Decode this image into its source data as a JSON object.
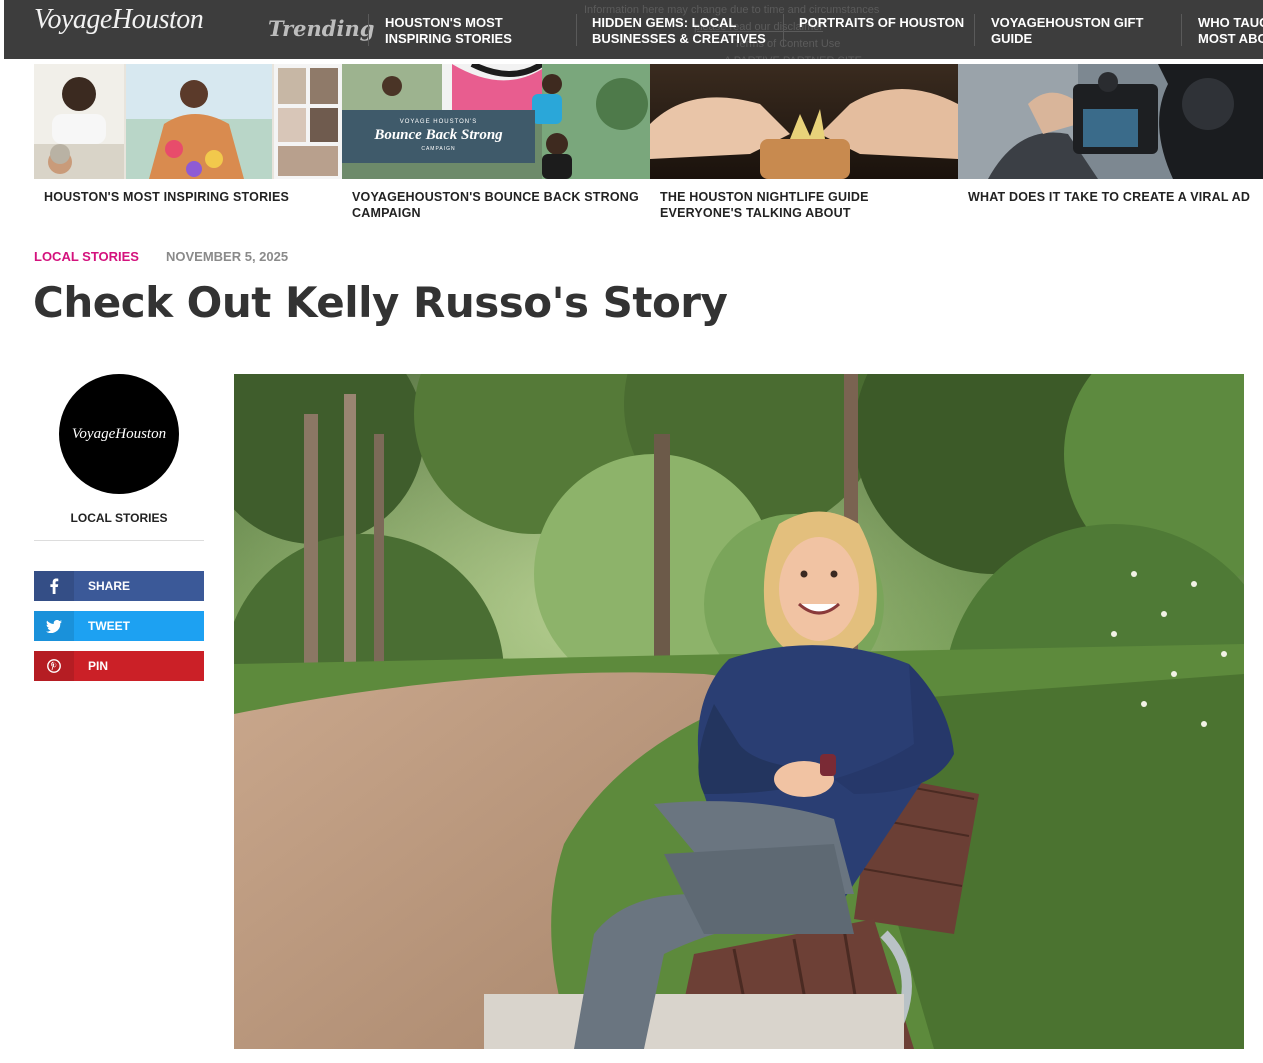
{
  "site": {
    "logo": "VoyageHouston",
    "trending_label": "Trending"
  },
  "nav": [
    {
      "label": "Houston's Most Inspiring Stories"
    },
    {
      "label": "Hidden Gems: Local Businesses & Creatives"
    },
    {
      "label": "Portraits of Houston"
    },
    {
      "label": "VoyageHouston Gift Guide"
    },
    {
      "label": "Who Taught You Most About"
    }
  ],
  "cards": [
    {
      "caption": "HOUSTON'S MOST INSPIRING STORIES"
    },
    {
      "caption": "VOYAGEHOUSTON'S BOUNCE BACK STRONG CAMPAIGN",
      "overlay_kicker": "VOYAGE HOUSTON'S",
      "overlay_title": "Bounce Back Strong",
      "overlay_sub": "CAMPAIGN"
    },
    {
      "caption": "THE HOUSTON NIGHTLIFE GUIDE EVERYONE'S TALKING ABOUT"
    },
    {
      "caption": "WHAT DOES IT TAKE TO CREATE A VIRAL AD"
    }
  ],
  "article": {
    "category": "LOCAL STORIES",
    "date": "NOVEMBER 5, 2025",
    "title": "Check Out Kelly Russo's Story"
  },
  "sidebar": {
    "avatar_text": "VoyageHouston",
    "category": "LOCAL STORIES",
    "share": {
      "facebook": "SHARE",
      "twitter": "TWEET",
      "pinterest": "PIN"
    }
  },
  "colors": {
    "topbar": "#3d3d3d",
    "category": "#d4127d",
    "facebook": "#3b5998",
    "twitter": "#1da1f2",
    "pinterest": "#cb2027"
  }
}
